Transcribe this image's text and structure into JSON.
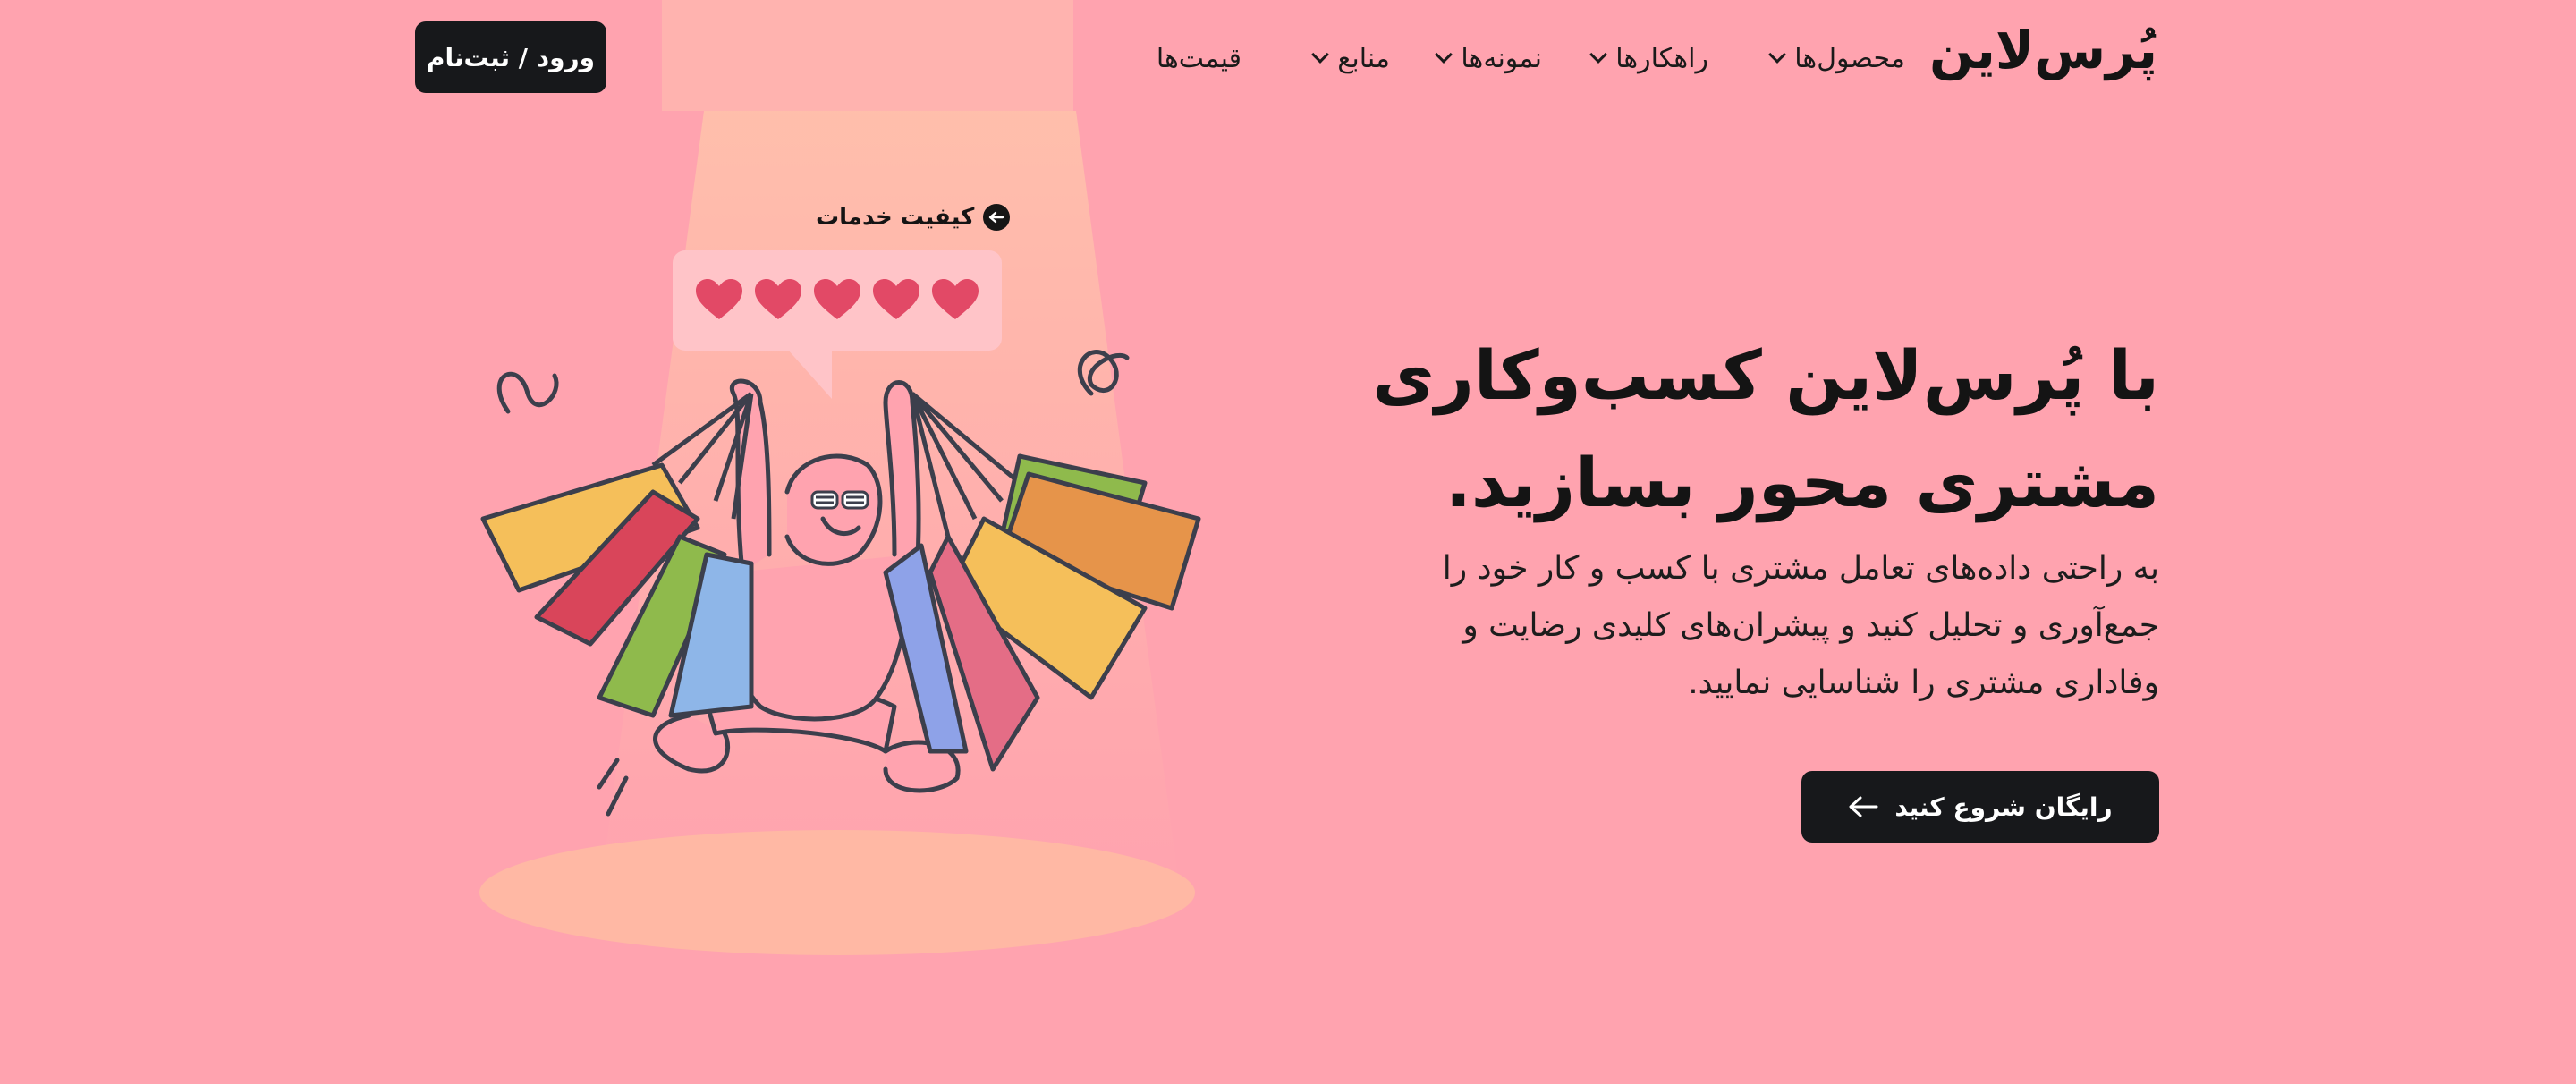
{
  "header": {
    "logo": "پُرس‌لاین",
    "nav": [
      {
        "label": "محصول‌ها"
      },
      {
        "label": "راهکارها"
      },
      {
        "label": "نمونه‌ها"
      },
      {
        "label": "منابع"
      },
      {
        "label": "قیمت‌ها"
      }
    ],
    "login_label": "ورود / ثبت‌نام"
  },
  "hero": {
    "title_line1": "با پُرس‌لاین کسب‌وکاری",
    "title_line2": "مشتری محور بسازید.",
    "description_line1": "به راحتی داده‌های تعامل مشتری با کسب و کار خود را",
    "description_line2": "جمع‌آوری و تحلیل کنید و پیشران‌های کلیدی رضایت و",
    "description_line3": "وفاداری مشتری را شناسایی نمایید.",
    "cta_label": "رایگان شروع کنید"
  },
  "illustration": {
    "quality_label": "کیفیت خدمات",
    "rating": 5,
    "rating_max": 5
  },
  "colors": {
    "background": "#ffa3af",
    "button": "#17181b",
    "heart": "#e24966",
    "spotlight": "#ffc8aa"
  }
}
